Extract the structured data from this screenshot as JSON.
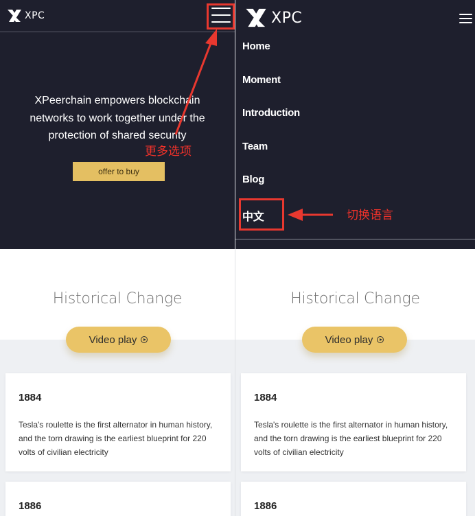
{
  "brand": {
    "logo_text": "XPC"
  },
  "hero": {
    "headline": "XPeerchain empowers blockchain networks to work together under the protection of shared security",
    "cta_label": "offer to buy"
  },
  "menu": {
    "items": [
      "Home",
      "Moment",
      "Introduction",
      "Team",
      "Blog",
      "中文"
    ]
  },
  "annotations": {
    "more_options": "更多选项",
    "switch_language": "切换语言",
    "color": "#e8382f"
  },
  "section": {
    "title": "Historical Change",
    "video_label": "Video play"
  },
  "timeline": [
    {
      "year": "1884",
      "text": "Tesla's roulette is the first alternator in human history, and the torn drawing is the earliest blueprint for 220 volts of civilian electricity"
    },
    {
      "year": "1886",
      "text": ""
    }
  ],
  "colors": {
    "dark_bg": "#1e1f2d",
    "accent_gold": "#e4bf62",
    "band_gray": "#eef0f3"
  },
  "icons": [
    "xpc-logo-icon",
    "hamburger-menu-icon",
    "play-circle-icon",
    "arrow-annotation-icon"
  ]
}
